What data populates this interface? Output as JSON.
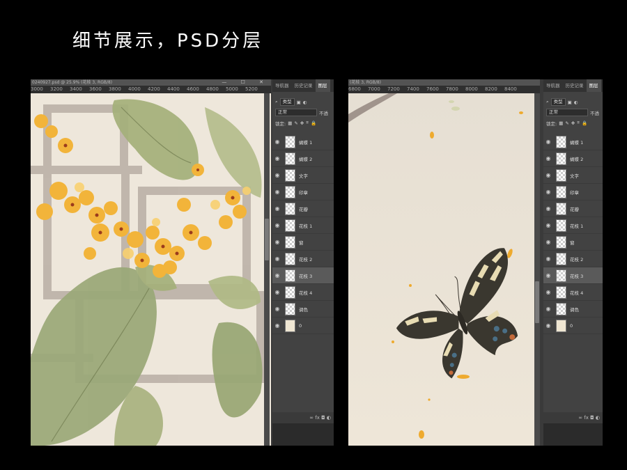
{
  "heading": "细节展示，PSD分层",
  "left": {
    "doc_title": "0240927.psd @ 25.9% (花枝 3, RGB/8)",
    "window_controls": "— ☐ ✕",
    "ruler": [
      "3000",
      "3200",
      "3400",
      "3600",
      "3800",
      "4000",
      "4200",
      "4400",
      "4600",
      "4800",
      "5000",
      "5200"
    ]
  },
  "right": {
    "doc_title": "(花枝 3, RGB/8)",
    "ruler": [
      "6800",
      "7000",
      "7200",
      "7400",
      "7600",
      "7800",
      "8000",
      "8200",
      "8400"
    ]
  },
  "panel": {
    "tabs": [
      "导航器",
      "历史记录",
      "图层"
    ],
    "filter_kind": "类型",
    "blend_mode": "正常",
    "opacity_label": "不透",
    "lock_label": "锁定:",
    "footer_icons": "∞  fx  ◘  ◐",
    "layers": [
      "蝴蝶 1",
      "蝴蝶 2",
      "文字",
      "印章",
      "花瓣",
      "花枝 1",
      "窗",
      "花枝 2",
      "花枝 3",
      "花枝 4",
      "调色",
      "0"
    ],
    "selected_layer": "花枝 3"
  },
  "colors": {
    "paper": "#eee7db",
    "panel": "#424242",
    "flower": "#f2b43a",
    "leaf": "#a4b07a"
  }
}
